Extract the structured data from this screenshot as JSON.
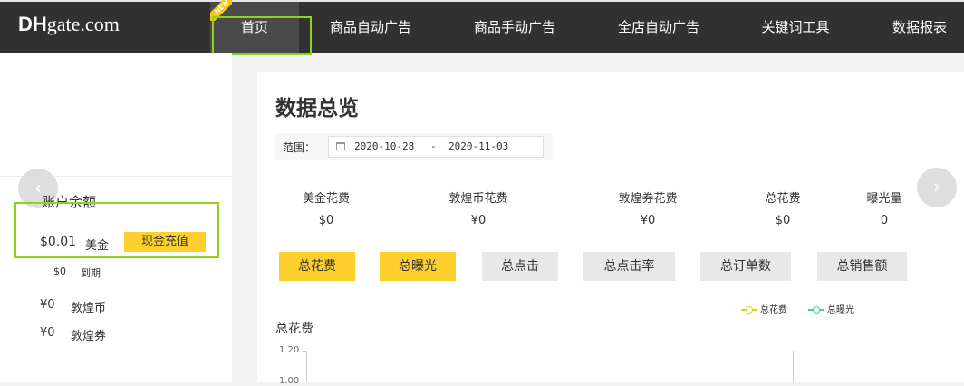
{
  "logo": {
    "bold": "DH",
    "rest": "gate.com"
  },
  "nav": {
    "new_badge": "NEW",
    "items": [
      {
        "label": "首页"
      },
      {
        "label": "商品自动广告"
      },
      {
        "label": "商品手动广告"
      },
      {
        "label": "全店自动广告"
      },
      {
        "label": "关键词工具"
      },
      {
        "label": "数据报表"
      }
    ]
  },
  "sidebar": {
    "balance_title": "账户余额",
    "usd_amount": "$0.01",
    "usd_label": "美金",
    "recharge_button": "现金充值",
    "expire_amount": "$0",
    "expire_label": "到期",
    "coin_amount": "¥0",
    "coin_label": "敦煌币",
    "coupon_amount": "¥0",
    "coupon_label": "敦煌券"
  },
  "main": {
    "title": "数据总览",
    "range_label": "范围：",
    "date_start": "2020-10-28",
    "date_sep": "-",
    "date_end": "2020-11-03",
    "stats": [
      {
        "label": "美金花费",
        "value": "$0"
      },
      {
        "label": "敦煌币花费",
        "value": "¥0"
      },
      {
        "label": "敦煌券花费",
        "value": "¥0"
      },
      {
        "label": "总花费",
        "value": "$0"
      },
      {
        "label": "曝光量",
        "value": "0"
      }
    ],
    "tabs": [
      {
        "label": "总花费",
        "active": true
      },
      {
        "label": "总曝光",
        "active": true
      },
      {
        "label": "总点击",
        "active": false
      },
      {
        "label": "总点击率",
        "active": false
      },
      {
        "label": "总订单数",
        "active": false
      },
      {
        "label": "总销售额",
        "active": false
      }
    ],
    "legend": [
      {
        "label": "总花费",
        "color": "#f5c518"
      },
      {
        "label": "总曝光",
        "color": "#3dcfa5"
      }
    ],
    "chart_title": "总花费",
    "ticks": [
      "1.20",
      "1.00"
    ]
  },
  "colors": {
    "accent": "#fdd02e",
    "orange": "#f5612a",
    "highlight": "#8dd21e",
    "topbar": "#313131"
  }
}
